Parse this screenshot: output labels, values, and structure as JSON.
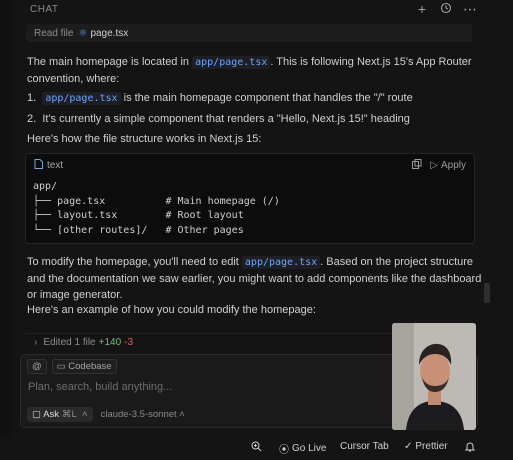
{
  "header": {
    "title": "CHAT",
    "icons": [
      "plus-icon",
      "history-icon",
      "more-icon"
    ]
  },
  "read_file": {
    "label": "Read file",
    "filename": "page.tsx"
  },
  "intro": {
    "pre": "The main homepage is located in ",
    "code": "app/page.tsx",
    "post": ". This is following Next.js 15's App Router convention, where:"
  },
  "list": [
    {
      "num": "1.",
      "code": "app/page.tsx",
      "text": " is the main homepage component that handles the \"/\" route"
    },
    {
      "num": "2.",
      "code": "",
      "text": "It's currently a simple component that renders a \"Hello, Next.js 15!\" heading"
    }
  ],
  "structure_text": "Here's how the file structure works in Next.js 15:",
  "codeblock": {
    "lang": "text",
    "apply_label": "Apply",
    "lines": [
      "app/",
      "├── page.tsx          # Main homepage (/)",
      "├── layout.tsx        # Root layout",
      "└── [other routes]/   # Other pages"
    ]
  },
  "modify": {
    "pre": "To modify the homepage, you'll need to edit ",
    "code": "app/page.tsx",
    "post": ". Based on the project structure and the documentation we saw earlier, you might want to add components like the dashboard or image generator."
  },
  "example_text": "Here's an example of how you could modify the homepage:",
  "edited": {
    "label": "Edited 1 file",
    "added": "+140",
    "removed": "-3"
  },
  "input": {
    "at_label": "@",
    "codebase_label": "Codebase",
    "placeholder": "Plan, search, build anything...",
    "ask_label": "Ask",
    "ask_shortcut": "⌘L",
    "model": "claude-3.5-sonnet"
  },
  "statusbar": {
    "go_live": "Go Live",
    "cursor_tab": "Cursor Tab",
    "prettier": "Prettier"
  }
}
